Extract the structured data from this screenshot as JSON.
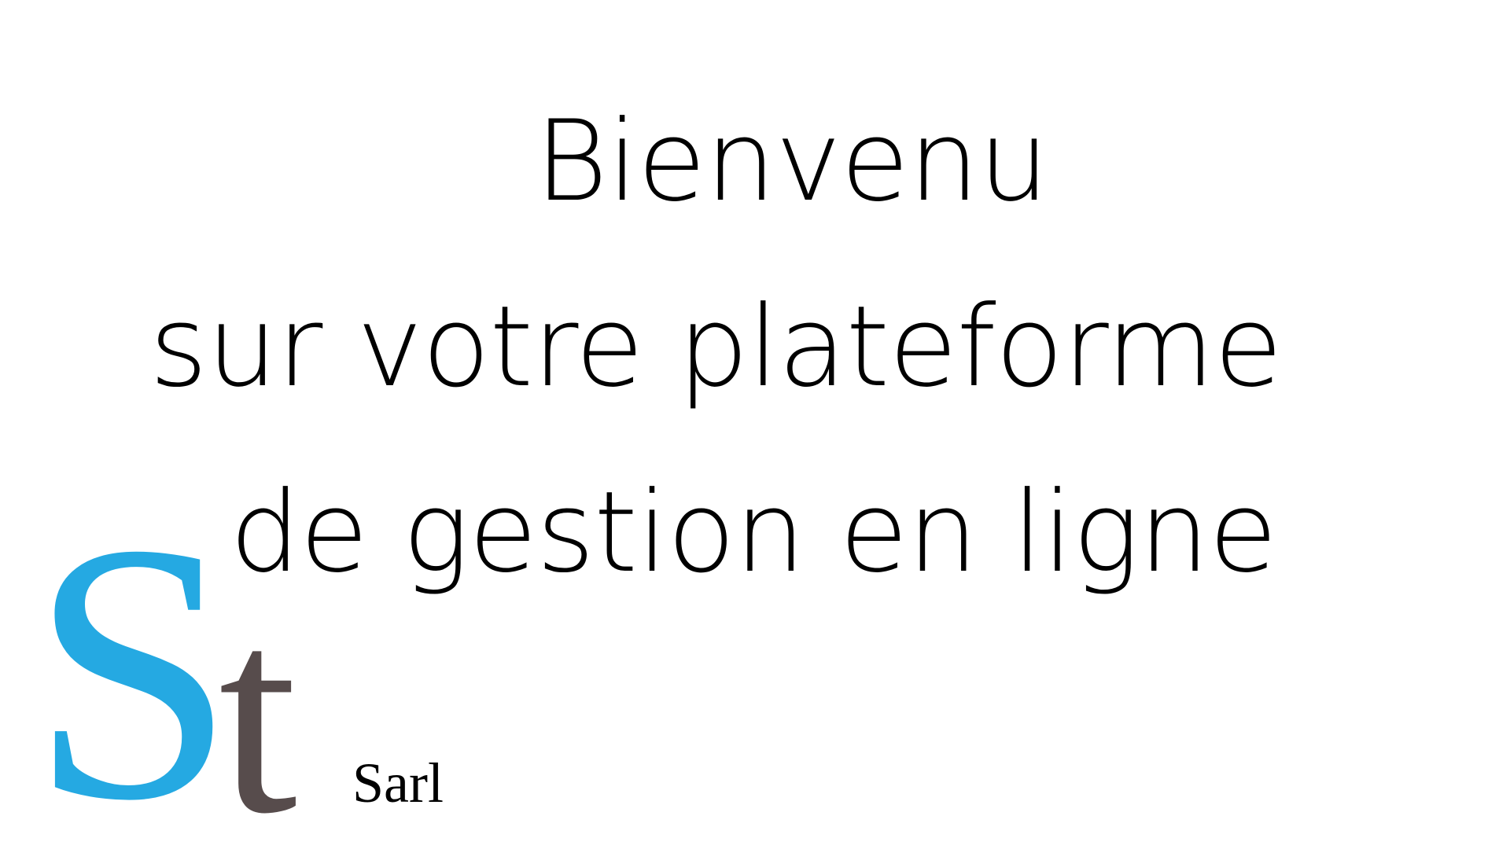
{
  "welcome": {
    "line1": "Bienvenu",
    "line2": "sur votre plateforme",
    "line3": "de gestion en ligne",
    "color": "#000000"
  },
  "logo": {
    "letter_s": "S",
    "letter_t": "t",
    "suffix": "Sarl",
    "color_s": "#25a9e2",
    "color_t": "#574c4c"
  }
}
